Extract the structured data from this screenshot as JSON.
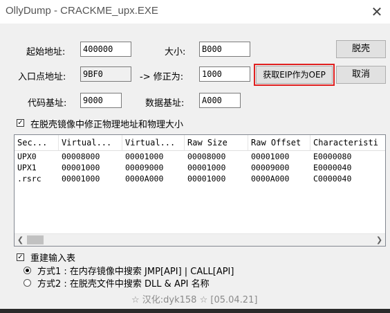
{
  "window": {
    "title": "OllyDump - CRACKME_upx.EXE",
    "close_glyph": "✕"
  },
  "fields": {
    "start_addr_label": "起始地址:",
    "start_addr_value": "400000",
    "size_label": "大小:",
    "size_value": "B000",
    "entry_label": "入口点地址:",
    "entry_value": "9BF0",
    "modify_label": "-> 修正为:",
    "modify_value": "1000",
    "code_base_label": "代码基址:",
    "code_base_value": "9000",
    "data_base_label": "数据基址:",
    "data_base_value": "A000"
  },
  "buttons": {
    "dump": "脱壳",
    "get_eip": "获取EIP作为OEP",
    "cancel": "取消"
  },
  "fix_checkbox": {
    "label": "在脱壳镜像中修正物理地址和物理大小",
    "checked": true
  },
  "table": {
    "headers": [
      "Sec...",
      "Virtual...",
      "Virtual...",
      "Raw Size",
      "Raw Offset",
      "Characteristi"
    ],
    "rows": [
      [
        "UPX0",
        "00008000",
        "00001000",
        "00008000",
        "00001000",
        "E0000080"
      ],
      [
        "UPX1",
        "00001000",
        "00009000",
        "00001000",
        "00009000",
        "E0000040"
      ],
      [
        ".rsrc",
        "00001000",
        "0000A000",
        "00001000",
        "0000A000",
        "C0000040"
      ]
    ]
  },
  "rebuild": {
    "label": "重建输入表",
    "checked": true,
    "method1": "方式1 : 在内存镜像中搜索 JMP[API] | CALL[API]",
    "method2": "方式2 : 在脱壳文件中搜索 DLL & API 名称",
    "selected": "method1"
  },
  "footer": "☆ 汉化:dyk158 ☆ [05.04.21]",
  "colors": {
    "highlight": "#e02020",
    "window_bg": "#f0f0f0"
  }
}
